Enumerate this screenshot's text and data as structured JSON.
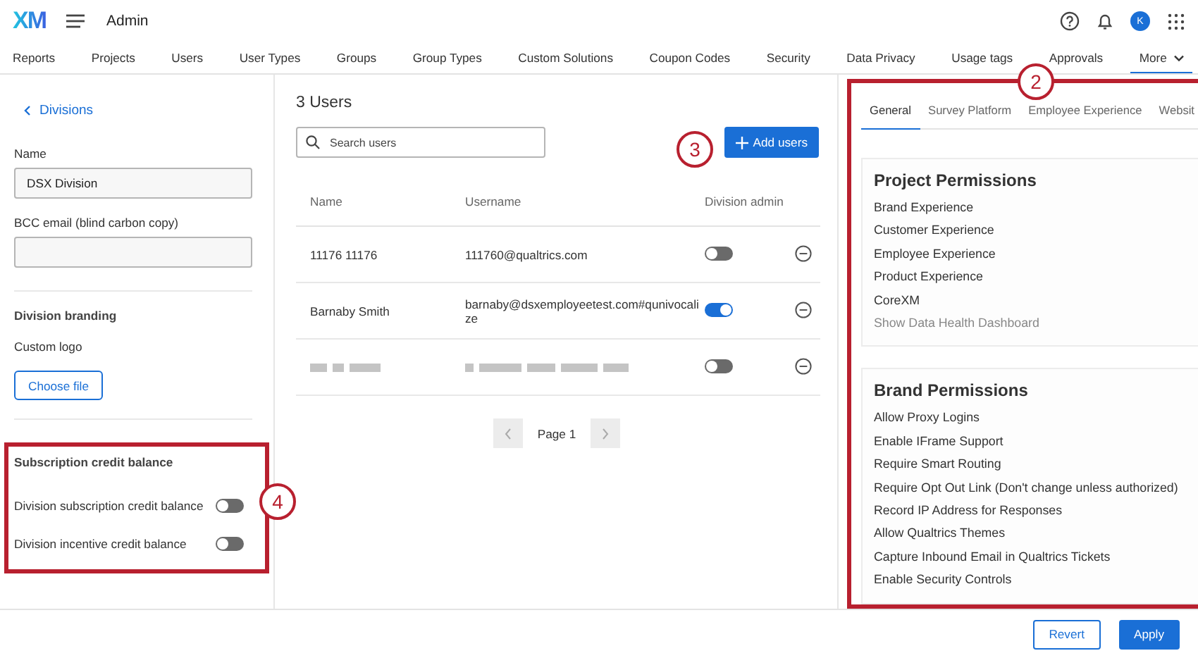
{
  "header": {
    "logo": "XM",
    "title": "Admin",
    "avatar": "K"
  },
  "nav_tabs": [
    {
      "label": "Reports",
      "selected": false
    },
    {
      "label": "Projects",
      "selected": false
    },
    {
      "label": "Users",
      "selected": false
    },
    {
      "label": "User Types",
      "selected": false
    },
    {
      "label": "Groups",
      "selected": false
    },
    {
      "label": "Group Types",
      "selected": false
    },
    {
      "label": "Custom Solutions",
      "selected": false
    },
    {
      "label": "Coupon Codes",
      "selected": false
    },
    {
      "label": "Security",
      "selected": false
    },
    {
      "label": "Data Privacy",
      "selected": false
    },
    {
      "label": "Usage tags",
      "selected": false
    },
    {
      "label": "Approvals",
      "selected": false
    },
    {
      "label": "More",
      "selected": true
    }
  ],
  "division": {
    "back_link": "Divisions",
    "fields": [
      {
        "label": "Name",
        "value": "DSX Division"
      },
      {
        "label": "BCC email (blind carbon copy)"
      }
    ],
    "branding": {
      "heading": "Division branding",
      "label": "Custom logo",
      "button": "Choose file"
    },
    "credit": {
      "heading": "Subscription credit balance",
      "toggles": [
        {
          "label": "Division subscription credit balance",
          "on": false
        },
        {
          "label": "Division incentive credit balance",
          "on": false
        }
      ]
    }
  },
  "users": {
    "title": "3 Users",
    "search": {
      "placeholder": "Search users"
    },
    "add_button": "Add users",
    "columns": [
      "Name",
      "Username",
      "Division admin"
    ],
    "rows": [
      {
        "kind": "user",
        "name": "11176 11176",
        "username": "111760@qualtrics.com",
        "admin": false
      },
      {
        "kind": "user",
        "name": "Barnaby Smith",
        "username": "barnaby@dsxemployeetest.com#qunivocalize",
        "admin": true
      },
      {
        "kind": "redacted",
        "admin": false
      }
    ],
    "page": "Page 1"
  },
  "permissions": {
    "tabs": [
      {
        "label": "General",
        "selected": true
      },
      {
        "label": "Survey Platform",
        "selected": false
      },
      {
        "label": "Employee Experience",
        "selected": false
      },
      {
        "label": "Websit",
        "selected": false
      }
    ],
    "sections": [
      {
        "title": "Project Permissions",
        "items": [
          {
            "label": "Brand Experience",
            "disabled": false
          },
          {
            "label": "Customer Experience",
            "disabled": false
          },
          {
            "label": "Employee Experience",
            "disabled": false
          },
          {
            "label": "Product Experience",
            "disabled": false
          },
          {
            "label": "CoreXM",
            "disabled": false
          },
          {
            "label": "Show Data Health Dashboard",
            "disabled": true
          }
        ]
      },
      {
        "title": "Brand Permissions",
        "items": [
          {
            "label": "Allow Proxy Logins",
            "disabled": false
          },
          {
            "label": "Enable IFrame Support",
            "disabled": false
          },
          {
            "label": "Require Smart Routing",
            "disabled": false
          },
          {
            "label": "Require Opt Out Link (Don't change unless authorized)",
            "disabled": false
          },
          {
            "label": "Record IP Address for Responses",
            "disabled": false
          },
          {
            "label": "Allow Qualtrics Themes",
            "disabled": false
          },
          {
            "label": "Capture Inbound Email in Qualtrics Tickets",
            "disabled": false
          },
          {
            "label": "Enable Security Controls",
            "disabled": false
          }
        ]
      }
    ]
  },
  "footer": {
    "buttons": [
      {
        "label": "Revert",
        "kind": "secondary"
      },
      {
        "label": "Apply",
        "kind": "primary"
      }
    ]
  },
  "callouts": [
    "2",
    "3",
    "4"
  ]
}
